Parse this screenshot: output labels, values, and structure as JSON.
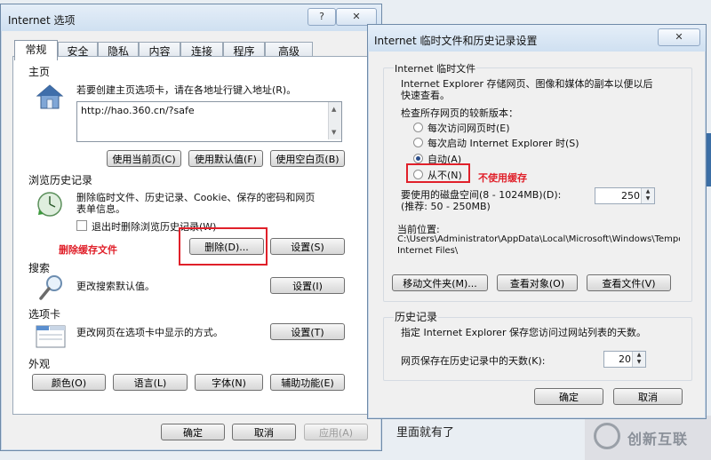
{
  "bg": {
    "caption": "里面就有了",
    "logo_text": "创新互联"
  },
  "opts": {
    "title": "Internet 选项",
    "help": "?",
    "close": "✕",
    "tabs": [
      "常规",
      "安全",
      "隐私",
      "内容",
      "连接",
      "程序",
      "高级"
    ],
    "home": {
      "title": "主页",
      "desc": "若要创建主页选项卡，请在各地址行键入地址(R)。",
      "url": "http://hao.360.cn/?safe",
      "btn_current": "使用当前页(C)",
      "btn_default": "使用默认值(F)",
      "btn_blank": "使用空白页(B)"
    },
    "history": {
      "title": "浏览历史记录",
      "desc1": "删除临时文件、历史记录、Cookie、保存的密码和网页",
      "desc2": "表单信息。",
      "chk": "退出时删除浏览历史记录(W)",
      "annot": "删除缓存文件",
      "btn_delete": "删除(D)...",
      "btn_settings": "设置(S)"
    },
    "search": {
      "title": "搜索",
      "desc": "更改搜索默认值。",
      "btn": "设置(I)"
    },
    "tabs_section": {
      "title": "选项卡",
      "desc": "更改网页在选项卡中显示的方式。",
      "btn": "设置(T)"
    },
    "appearance": {
      "title": "外观",
      "btn_colors": "颜色(O)",
      "btn_lang": "语言(L)",
      "btn_fonts": "字体(N)",
      "btn_access": "辅助功能(E)"
    },
    "ok": "确定",
    "cancel": "取消",
    "apply": "应用(A)"
  },
  "temp": {
    "title": "Internet 临时文件和历史记录设置",
    "close": "✕",
    "group1": "Internet 临时文件",
    "desc1": "Internet Explorer 存储网页、图像和媒体的副本以便以后",
    "desc2": "快速查看。",
    "check_label": "检查所存网页的较新版本：",
    "radios": [
      "每次访问网页时(E)",
      "每次启动 Internet Explorer 时(S)",
      "自动(A)",
      "从不(N)"
    ],
    "selected": "自动(A)",
    "annot": "不使用缓存",
    "disk_label1": "要使用的磁盘空间(8 - 1024MB)(D):",
    "disk_label2": "(推荐: 50 - 250MB)",
    "disk_value": "250",
    "loc_label": "当前位置:",
    "loc_path1": "C:\\Users\\Administrator\\AppData\\Local\\Microsoft\\Windows\\Temporary",
    "loc_path2": "Internet Files\\",
    "btn_move": "移动文件夹(M)...",
    "btn_objects": "查看对象(O)",
    "btn_files": "查看文件(V)",
    "group2": "历史记录",
    "hist_desc": "指定 Internet Explorer 保存您访问过网站列表的天数。",
    "days_label": "网页保存在历史记录中的天数(K):",
    "days_value": "20",
    "ok": "确定",
    "cancel": "取消"
  }
}
